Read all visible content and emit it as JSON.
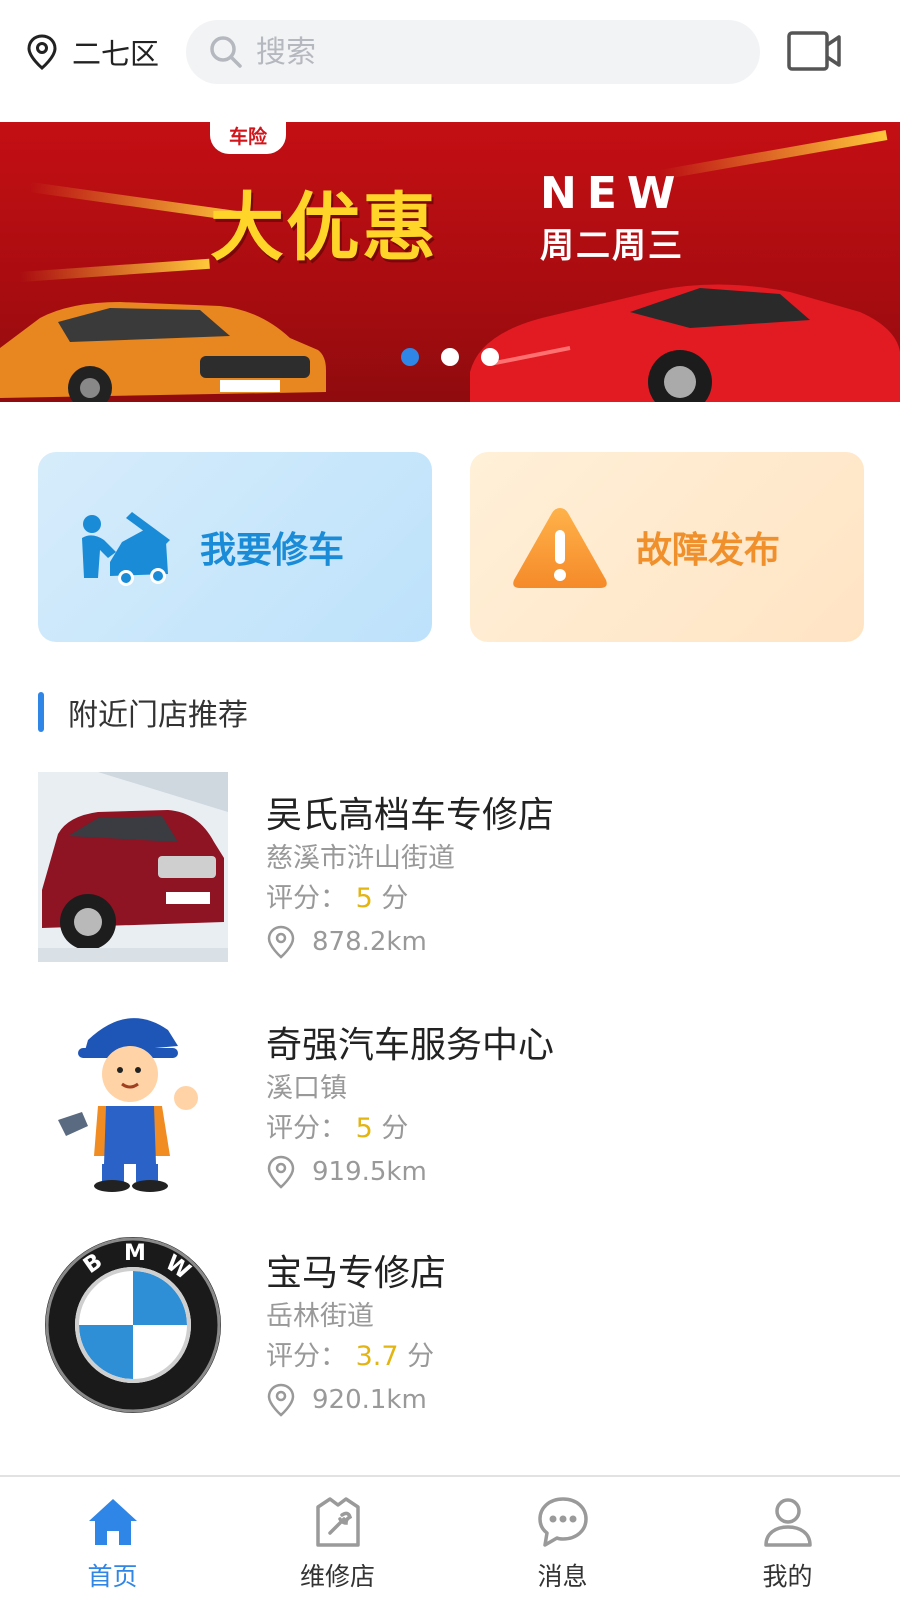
{
  "header": {
    "location": "二七区",
    "location_icon": "location-pin-icon",
    "search_placeholder": "搜索",
    "search_icon": "search-icon",
    "video_icon": "video-camera-icon"
  },
  "banner": {
    "tag": "车险",
    "headline": "大优惠",
    "badge": "NEW",
    "days": "周二周三",
    "slides_total": 3,
    "active_slide": 1
  },
  "actions": {
    "repair": {
      "label": "我要修车",
      "icon": "car-repair-icon"
    },
    "fault": {
      "label": "故障发布",
      "icon": "warning-icon"
    }
  },
  "nearby": {
    "title": "附近门店推荐",
    "rating_prefix": "评分：",
    "rating_unit": "分",
    "shops": [
      {
        "name": "吴氏高档车专修店",
        "address": "慈溪市浒山街道",
        "score": "5",
        "distance": "878.2km",
        "image": "red-suv-photo"
      },
      {
        "name": "奇强汽车服务中心",
        "address": "溪口镇",
        "score": "5",
        "distance": "919.5km",
        "image": "geely-mechanic-mascot"
      },
      {
        "name": "宝马专修店",
        "address": "岳林街道",
        "score": "3.7",
        "distance": "920.1km",
        "image": "bmw-logo"
      }
    ]
  },
  "nav": {
    "home": "首页",
    "shops": "维修店",
    "messages": "消息",
    "mine": "我的",
    "active": "home"
  },
  "colors": {
    "accent": "#2f86e6",
    "rating": "#e2b512",
    "repair_text": "#1a8bd7",
    "fault_text": "#f0902c"
  }
}
